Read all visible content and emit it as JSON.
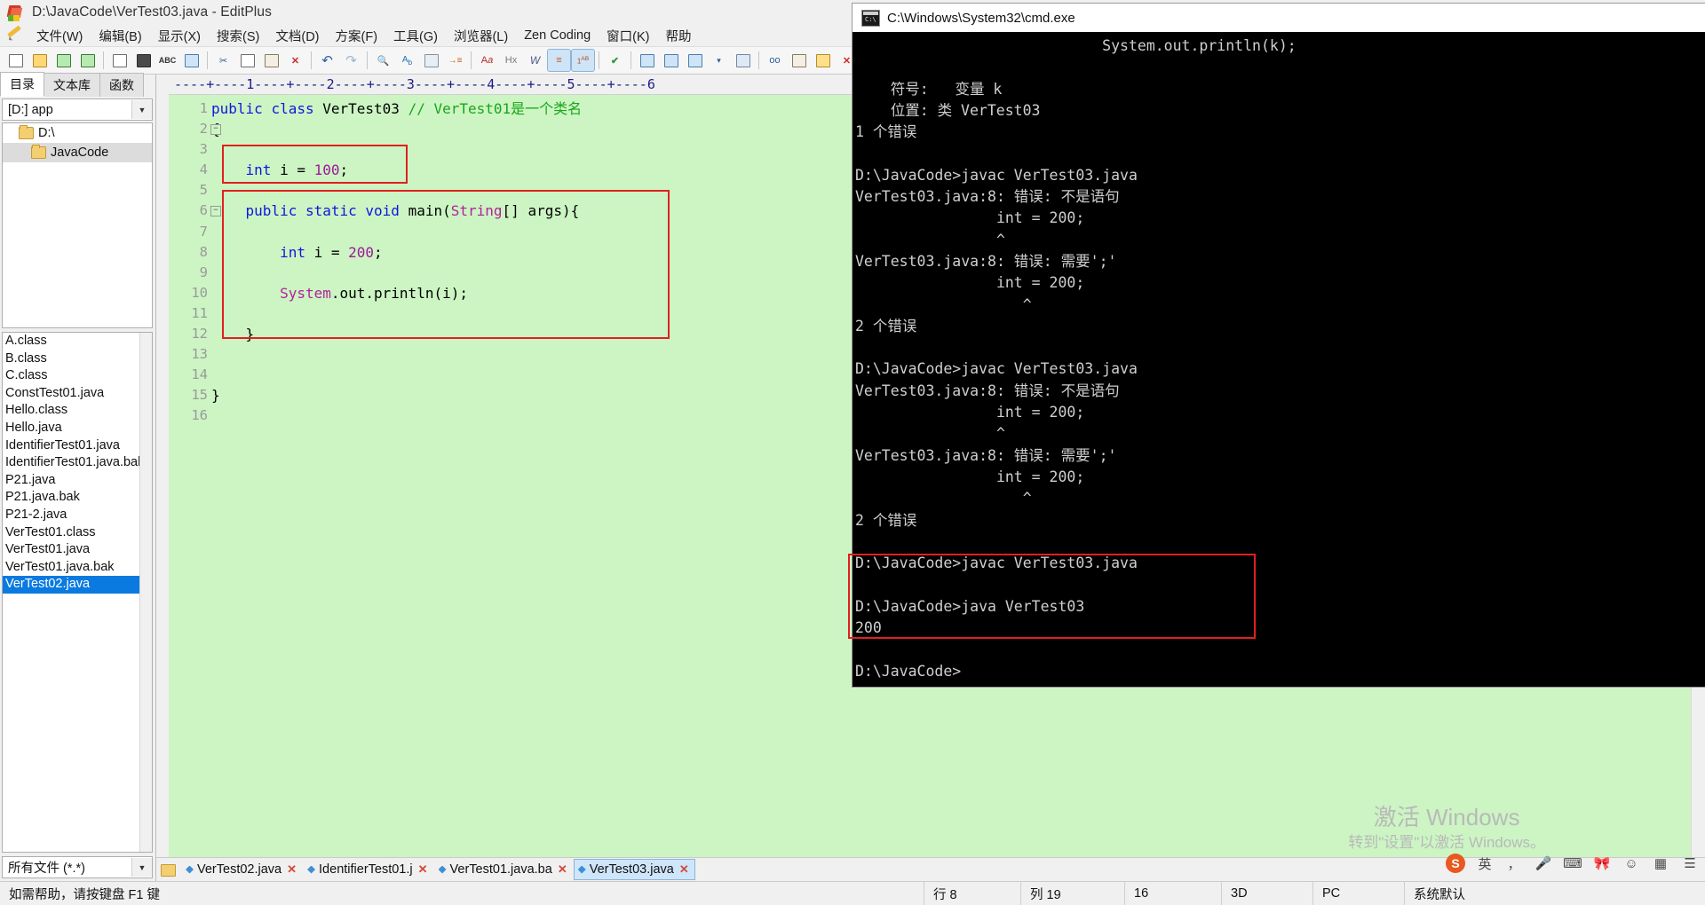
{
  "window": {
    "title": "D:\\JavaCode\\VerTest03.java - EditPlus",
    "app_icon": "editplus-icon"
  },
  "menu": {
    "items": [
      "文件(W)",
      "编辑(B)",
      "显示(X)",
      "搜索(S)",
      "文档(D)",
      "方案(F)",
      "工具(G)",
      "浏览器(L)",
      "Zen Coding",
      "窗口(K)",
      "帮助"
    ]
  },
  "toolbar": {
    "buttons": [
      {
        "name": "new-file",
        "glyph": "new"
      },
      {
        "name": "open-file",
        "glyph": "folder"
      },
      {
        "name": "save-file",
        "glyph": "save"
      },
      {
        "name": "save-all",
        "glyph": "saveall"
      },
      {
        "name": "page-setup",
        "glyph": "page"
      },
      {
        "name": "print",
        "glyph": "print"
      },
      {
        "name": "spell-check",
        "glyph": "abc"
      },
      {
        "name": "preview",
        "glyph": "prev"
      },
      {
        "name": "cut",
        "glyph": "cut"
      },
      {
        "name": "copy",
        "glyph": "copy"
      },
      {
        "name": "paste",
        "glyph": "paste"
      },
      {
        "name": "delete",
        "glyph": "del"
      },
      {
        "name": "undo",
        "glyph": "undo"
      },
      {
        "name": "redo",
        "glyph": "redo"
      },
      {
        "name": "find",
        "glyph": "find"
      },
      {
        "name": "replace",
        "glyph": "replace"
      },
      {
        "name": "find-in-files",
        "glyph": "findfiles"
      },
      {
        "name": "goto-line",
        "glyph": "goto"
      },
      {
        "name": "font",
        "glyph": "Aa"
      },
      {
        "name": "hex-view",
        "glyph": "Hx"
      },
      {
        "name": "word-wrap",
        "glyph": "W"
      },
      {
        "name": "toggle-ruler",
        "glyph": "ruler"
      },
      {
        "name": "line-numbers",
        "glyph": "1AB"
      },
      {
        "name": "spell",
        "glyph": "check"
      },
      {
        "name": "preview-browser",
        "glyph": "browser"
      },
      {
        "name": "split-view",
        "glyph": "split"
      },
      {
        "name": "more",
        "glyph": "more"
      }
    ]
  },
  "left_panel": {
    "tabs": [
      {
        "label": "目录",
        "active": true
      },
      {
        "label": "文本库",
        "active": false
      },
      {
        "label": "函数",
        "active": false
      }
    ],
    "drive_combo": "[D:] app",
    "tree": [
      {
        "label": "D:\\",
        "level": 1,
        "selected": false
      },
      {
        "label": "JavaCode",
        "level": 2,
        "selected": true
      }
    ],
    "files": [
      {
        "name": "A.class",
        "selected": false
      },
      {
        "name": "B.class",
        "selected": false
      },
      {
        "name": "C.class",
        "selected": false
      },
      {
        "name": "ConstTest01.java",
        "selected": false
      },
      {
        "name": "Hello.class",
        "selected": false
      },
      {
        "name": "Hello.java",
        "selected": false
      },
      {
        "name": "IdentifierTest01.java",
        "selected": false
      },
      {
        "name": "IdentifierTest01.java.bak",
        "selected": false
      },
      {
        "name": "P21.java",
        "selected": false
      },
      {
        "name": "P21.java.bak",
        "selected": false
      },
      {
        "name": "P21-2.java",
        "selected": false
      },
      {
        "name": "VerTest01.class",
        "selected": false
      },
      {
        "name": "VerTest01.java",
        "selected": false
      },
      {
        "name": "VerTest01.java.bak",
        "selected": false
      },
      {
        "name": "VerTest02.java",
        "selected": true
      }
    ],
    "filter": "所有文件 (*.*)"
  },
  "editor": {
    "ruler": "----+----1----+----2----+----3----+----4----+----5----+----6",
    "lines": [
      {
        "n": 1,
        "fold": "",
        "segments": [
          {
            "t": "public ",
            "c": "kw"
          },
          {
            "t": "class ",
            "c": "kw"
          },
          {
            "t": "VerTest03 ",
            "c": ""
          },
          {
            "t": "// VerTest01是一个类名",
            "c": "cmt"
          }
        ]
      },
      {
        "n": 2,
        "fold": "-",
        "segments": [
          {
            "t": "{",
            "c": ""
          }
        ]
      },
      {
        "n": 3,
        "fold": "",
        "segments": [
          {
            "t": "",
            "c": ""
          }
        ]
      },
      {
        "n": 4,
        "fold": "",
        "segments": [
          {
            "t": "    ",
            "c": ""
          },
          {
            "t": "int",
            "c": "kw"
          },
          {
            "t": " i = ",
            "c": ""
          },
          {
            "t": "100",
            "c": "num"
          },
          {
            "t": ";",
            "c": ""
          }
        ]
      },
      {
        "n": 5,
        "fold": "",
        "segments": [
          {
            "t": "",
            "c": ""
          }
        ]
      },
      {
        "n": 6,
        "fold": "-",
        "segments": [
          {
            "t": "    ",
            "c": ""
          },
          {
            "t": "public ",
            "c": "kw"
          },
          {
            "t": "static ",
            "c": "kw"
          },
          {
            "t": "void ",
            "c": "kw"
          },
          {
            "t": "main(",
            "c": ""
          },
          {
            "t": "String",
            "c": "cls"
          },
          {
            "t": "[] args){",
            "c": ""
          }
        ]
      },
      {
        "n": 7,
        "fold": "",
        "segments": [
          {
            "t": "",
            "c": ""
          }
        ]
      },
      {
        "n": 8,
        "fold": "",
        "segments": [
          {
            "t": "        ",
            "c": ""
          },
          {
            "t": "int",
            "c": "kw"
          },
          {
            "t": " i = ",
            "c": ""
          },
          {
            "t": "200",
            "c": "num"
          },
          {
            "t": ";",
            "c": ""
          }
        ]
      },
      {
        "n": 9,
        "fold": "",
        "segments": [
          {
            "t": "",
            "c": ""
          }
        ]
      },
      {
        "n": 10,
        "fold": "",
        "segments": [
          {
            "t": "        ",
            "c": ""
          },
          {
            "t": "System",
            "c": "cls"
          },
          {
            "t": ".out.println(i);",
            "c": ""
          }
        ]
      },
      {
        "n": 11,
        "fold": "",
        "segments": [
          {
            "t": "",
            "c": ""
          }
        ]
      },
      {
        "n": 12,
        "fold": "",
        "segments": [
          {
            "t": "    }",
            "c": ""
          }
        ]
      },
      {
        "n": 13,
        "fold": "",
        "segments": [
          {
            "t": "",
            "c": ""
          }
        ]
      },
      {
        "n": 14,
        "fold": "",
        "segments": [
          {
            "t": "",
            "c": ""
          }
        ]
      },
      {
        "n": 15,
        "fold": "",
        "segments": [
          {
            "t": "}",
            "c": ""
          }
        ]
      },
      {
        "n": 16,
        "fold": "",
        "segments": [
          {
            "t": "",
            "c": ""
          }
        ]
      }
    ],
    "highlight_color": "#e02020",
    "background_color": "#ccf5c3"
  },
  "file_tabs": [
    {
      "label": "VerTest02.java",
      "active": false
    },
    {
      "label": "IdentifierTest01.j",
      "active": false
    },
    {
      "label": "VerTest01.java.ba",
      "active": false
    },
    {
      "label": "VerTest03.java",
      "active": true
    }
  ],
  "status_bar": {
    "hint": "如需帮助，请按键盘 F1 键",
    "line": "行 8",
    "col": "列 19",
    "sel": "16",
    "mode": "3D",
    "platform": "PC",
    "encoding": "系统默认"
  },
  "cmd": {
    "title": "C:\\Windows\\System32\\cmd.exe",
    "icon": "cmd-icon",
    "lines": [
      "                            System.out.println(k);",
      "",
      "    符号:   变量 k",
      "    位置: 类 VerTest03",
      "1 个错误",
      "",
      "D:\\JavaCode>javac VerTest03.java",
      "VerTest03.java:8: 错误: 不是语句",
      "                int = 200;",
      "                ^",
      "VerTest03.java:8: 错误: 需要';'",
      "                int = 200;",
      "                   ^",
      "2 个错误",
      "",
      "D:\\JavaCode>javac VerTest03.java",
      "VerTest03.java:8: 错误: 不是语句",
      "                int = 200;",
      "                ^",
      "VerTest03.java:8: 错误: 需要';'",
      "                int = 200;",
      "                   ^",
      "2 个错误",
      "",
      "D:\\JavaCode>javac VerTest03.java",
      "",
      "D:\\JavaCode>java VerTest03",
      "200",
      "",
      "D:\\JavaCode>"
    ],
    "highlight_color": "#e02020"
  },
  "watermark": {
    "line1": "激活 Windows",
    "line2": "转到\"设置\"以激活 Windows。"
  },
  "tray": {
    "items": [
      {
        "name": "sogou-pinyin-icon",
        "glyph": "S"
      },
      {
        "name": "ime-chinese-icon",
        "glyph": "英"
      },
      {
        "name": "ime-punctuation-icon",
        "glyph": "，"
      },
      {
        "name": "microphone-icon",
        "glyph": "🎤"
      },
      {
        "name": "keyboard-icon",
        "glyph": "⌨"
      },
      {
        "name": "bowtie-icon",
        "glyph": "🎀"
      },
      {
        "name": "emoji-icon",
        "glyph": "☺"
      },
      {
        "name": "toolbox-icon",
        "glyph": "▦"
      },
      {
        "name": "menu-icon",
        "glyph": "☰"
      }
    ]
  }
}
